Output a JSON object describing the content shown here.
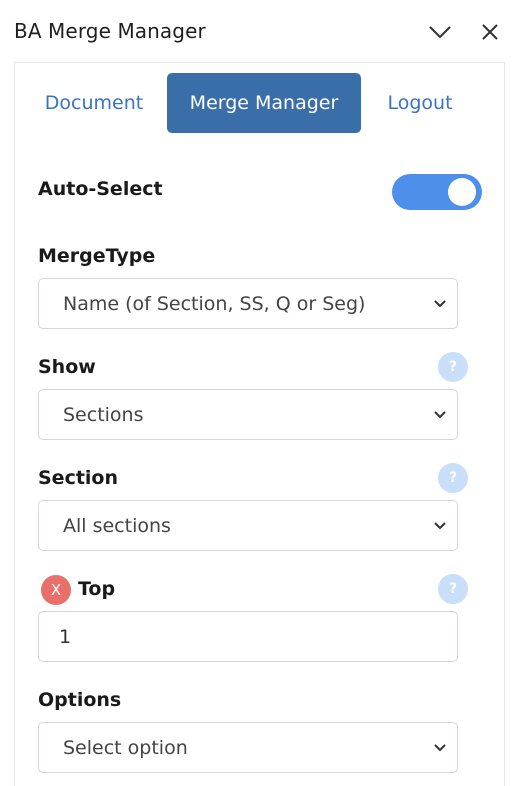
{
  "window": {
    "title": "BA Merge Manager",
    "collapse_icon": "chevron-down-icon",
    "close_icon": "close-icon"
  },
  "tabs": [
    {
      "label": "Document",
      "active": false
    },
    {
      "label": "Merge Manager",
      "active": true
    },
    {
      "label": "Logout",
      "active": false
    }
  ],
  "form": {
    "auto_select": {
      "label": "Auto-Select",
      "enabled": true
    },
    "merge_type": {
      "label": "MergeType",
      "value": "Name (of Section, SS, Q or Seg)"
    },
    "show": {
      "label": "Show",
      "value": "Sections",
      "help": "?"
    },
    "section": {
      "label": "Section",
      "value": "All sections",
      "help": "?"
    },
    "top": {
      "label": "Top",
      "value": "1",
      "clear": "X",
      "help": "?"
    },
    "options": {
      "label": "Options",
      "value": "Select option"
    }
  },
  "colors": {
    "accent": "#3a6ea8",
    "link": "#3a73c2",
    "toggle_on": "#4d8fea",
    "help_bg": "#c9def8",
    "clear_bg": "#e9706a"
  }
}
